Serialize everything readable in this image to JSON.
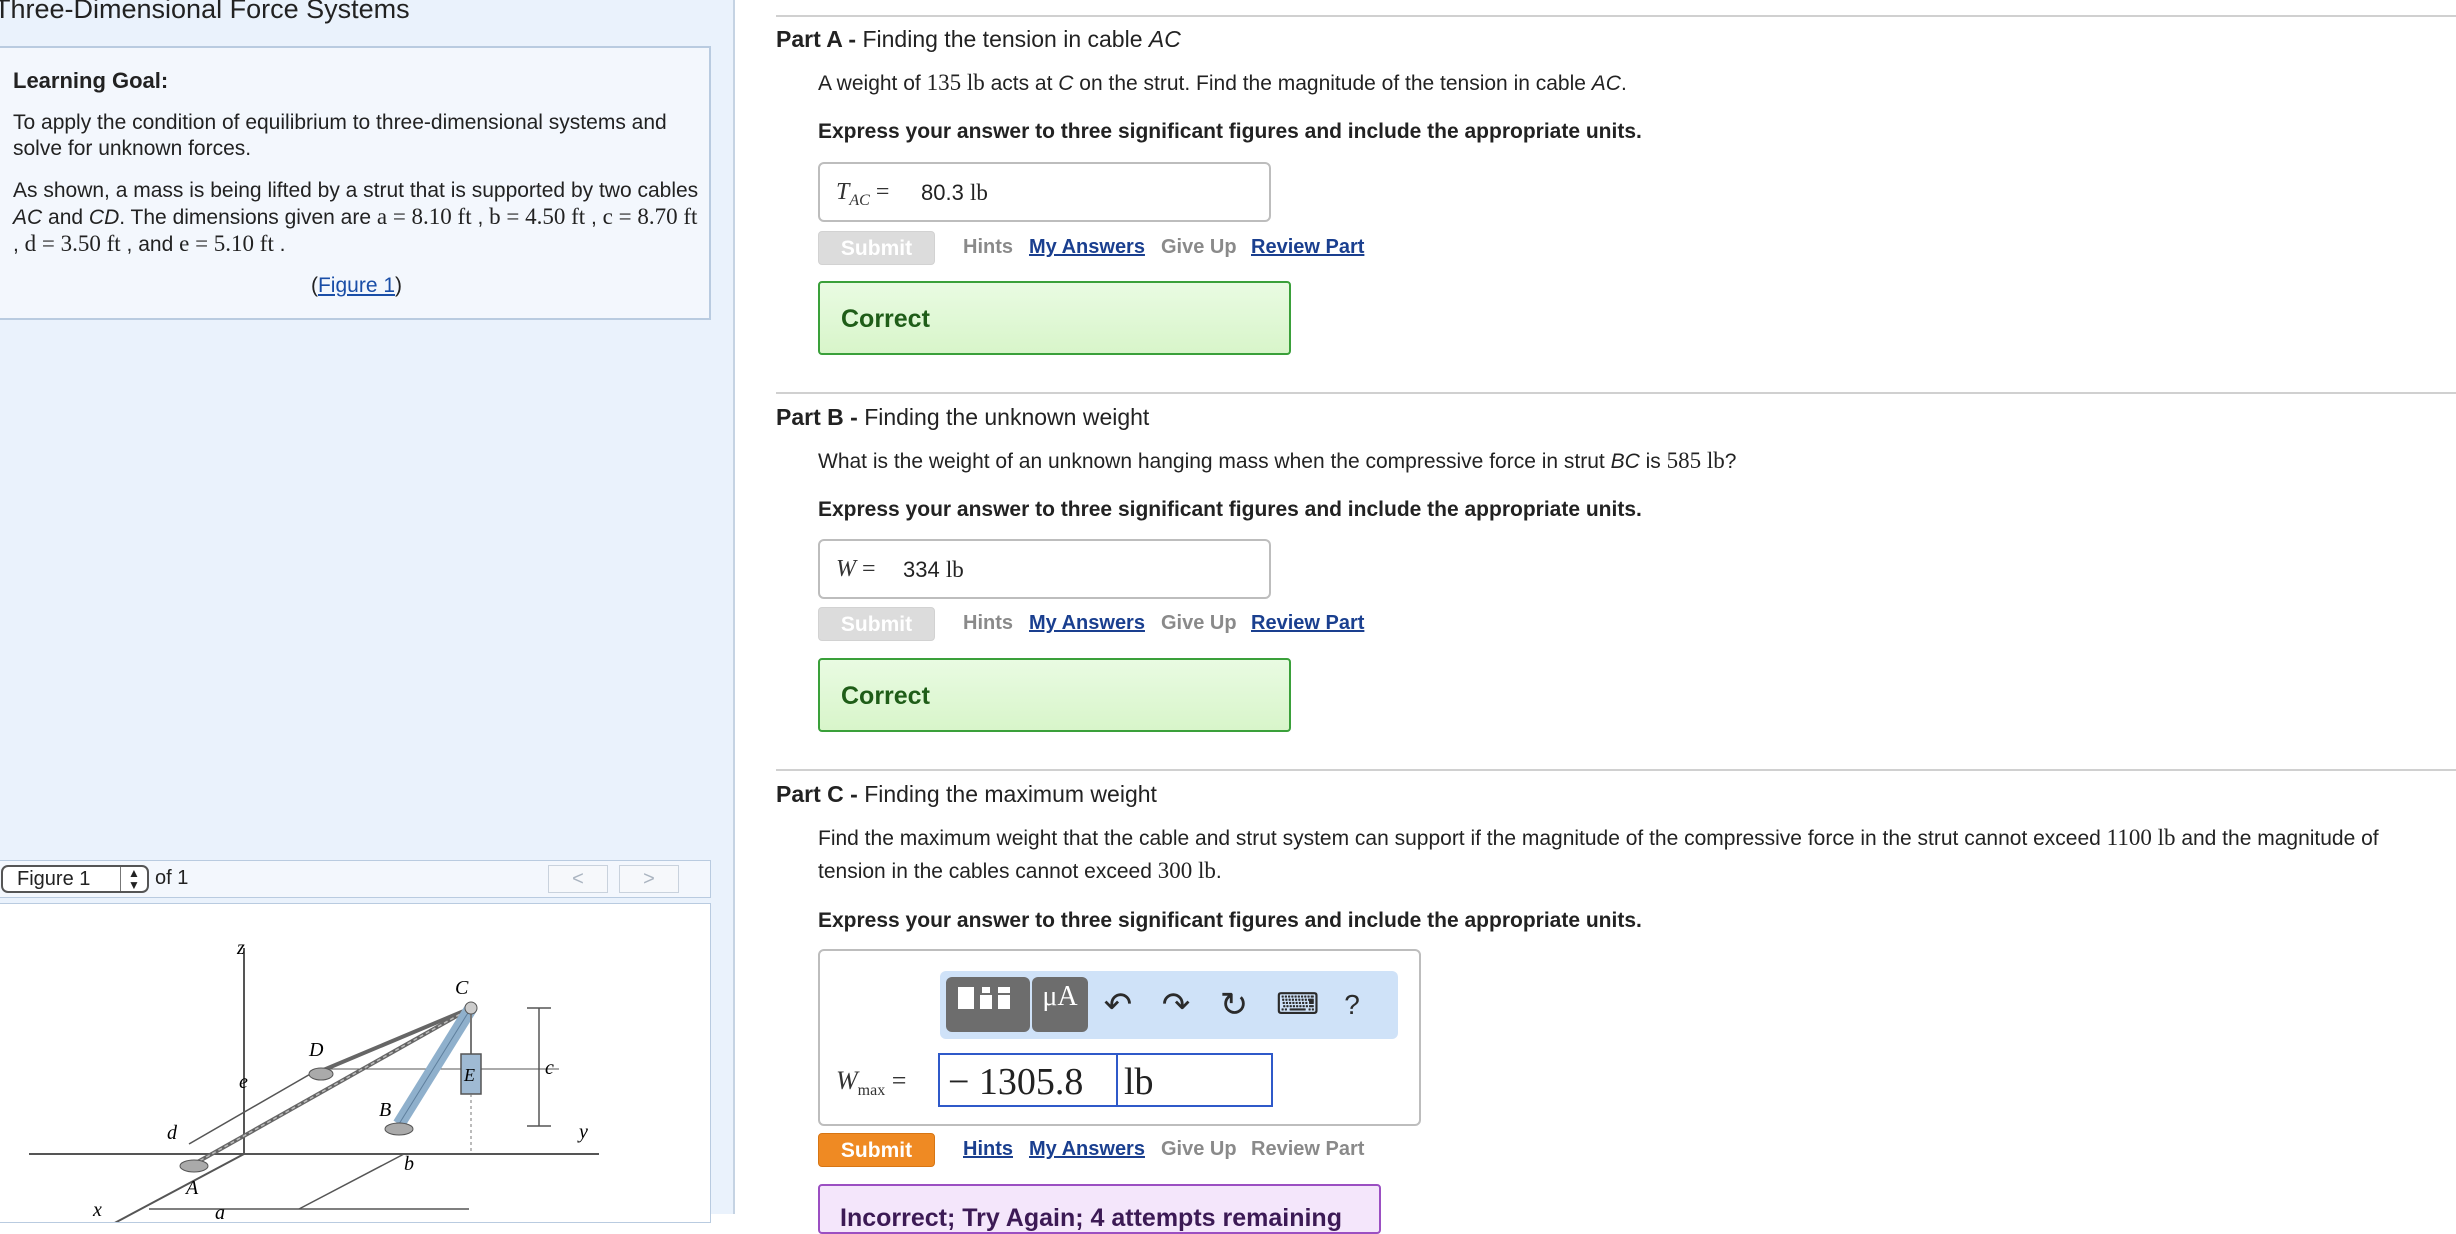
{
  "assignment_title": "Three-Dimensional Force Systems",
  "learning_goal": {
    "heading": "Learning Goal:",
    "text": "To apply the condition of equilibrium to three-dimensional systems and solve for unknown forces."
  },
  "problem": {
    "intro": "As shown, a mass is being lifted by a strut that is supported by two cables",
    "cable1": "AC",
    "and1": "and",
    "cable2": "CD",
    "dims_intro": ". The dimensions given are",
    "a": "a = 8.10 ft",
    "b": "b = 4.50 ft",
    "c": "c = 8.70 ft",
    "d": "d = 3.50 ft",
    "and2": "and",
    "e": "e = 5.10 ft",
    "figure_link": "Figure 1"
  },
  "figure_nav": {
    "select_value": "Figure 1",
    "of_text": "of 1",
    "prev": "<",
    "next": ">"
  },
  "figure_labels": {
    "z": "z",
    "y": "y",
    "x": "x",
    "A": "A",
    "B": "B",
    "C": "C",
    "D": "D",
    "E": "E",
    "a": "a",
    "b": "b",
    "c": "c",
    "d": "d",
    "e": "e"
  },
  "parts": [
    {
      "heading_prefix": "Part A -",
      "heading_title": "Finding the tension in cable",
      "heading_italic": "AC",
      "question_pre": "A weight of",
      "question_value": "135 lb",
      "question_mid": "acts at",
      "question_pt": "C",
      "question_mid2": "on the strut. Find the magnitude of the tension in cable",
      "question_cable": "AC",
      "question_end": ".",
      "instruction": "Express your answer to three significant figures and include the appropriate units.",
      "answer_var": "T",
      "answer_sub": "AC",
      "answer_eq": "=",
      "answer_num": "80.3",
      "answer_unit": "lb",
      "submit": "Submit",
      "hints": "Hints",
      "my_answers": "My Answers",
      "give_up": "Give Up",
      "review_part": "Review Part",
      "feedback": "Correct"
    },
    {
      "heading_prefix": "Part B -",
      "heading_title": "Finding the unknown weight",
      "question_pre": "What is the weight of an unknown hanging mass when the compressive force in strut",
      "question_strut": "BC",
      "question_mid": "is",
      "question_value": "585 lb",
      "question_end": "?",
      "instruction": "Express your answer to three significant figures and include the appropriate units.",
      "answer_var": "W",
      "answer_eq": "=",
      "answer_num": "334",
      "answer_unit": "lb",
      "submit": "Submit",
      "hints": "Hints",
      "my_answers": "My Answers",
      "give_up": "Give Up",
      "review_part": "Review Part",
      "feedback": "Correct"
    },
    {
      "heading_prefix": "Part C -",
      "heading_title": "Finding the maximum weight",
      "question_line1_pre": "Find the maximum weight that the cable and strut system can support if the magnitude of the compressive force in the strut cannot exceed",
      "question_value1": "1100 lb",
      "question_line1_end": "and the magnitude of",
      "question_line2_pre": "tension in the cables cannot exceed",
      "question_value2": "300 lb",
      "question_line2_end": ".",
      "instruction": "Express your answer to three significant figures and include the appropriate units.",
      "toolbar": {
        "templates_icon": "templates-icon",
        "units_label": "μA",
        "undo_icon": "↶",
        "redo_icon": "↷",
        "reset_icon": "↻",
        "keyboard_icon": "⌨",
        "help_label": "?"
      },
      "answer_var": "W",
      "answer_sub": "max",
      "answer_eq": "=",
      "answer_value": "− 1305.8",
      "answer_unit": "lb",
      "submit": "Submit",
      "hints": "Hints",
      "my_answers": "My Answers",
      "give_up": "Give Up",
      "review_part": "Review Part",
      "feedback": "Incorrect; Try Again; 4 attempts remaining"
    }
  ],
  "colors": {
    "submit_active": "#ef8a23",
    "correct_border": "#3aa03a",
    "incorrect_border": "#9b4fc2",
    "link_blue": "#1a3f8f",
    "left_panel_bg": "#eaf2fc"
  }
}
